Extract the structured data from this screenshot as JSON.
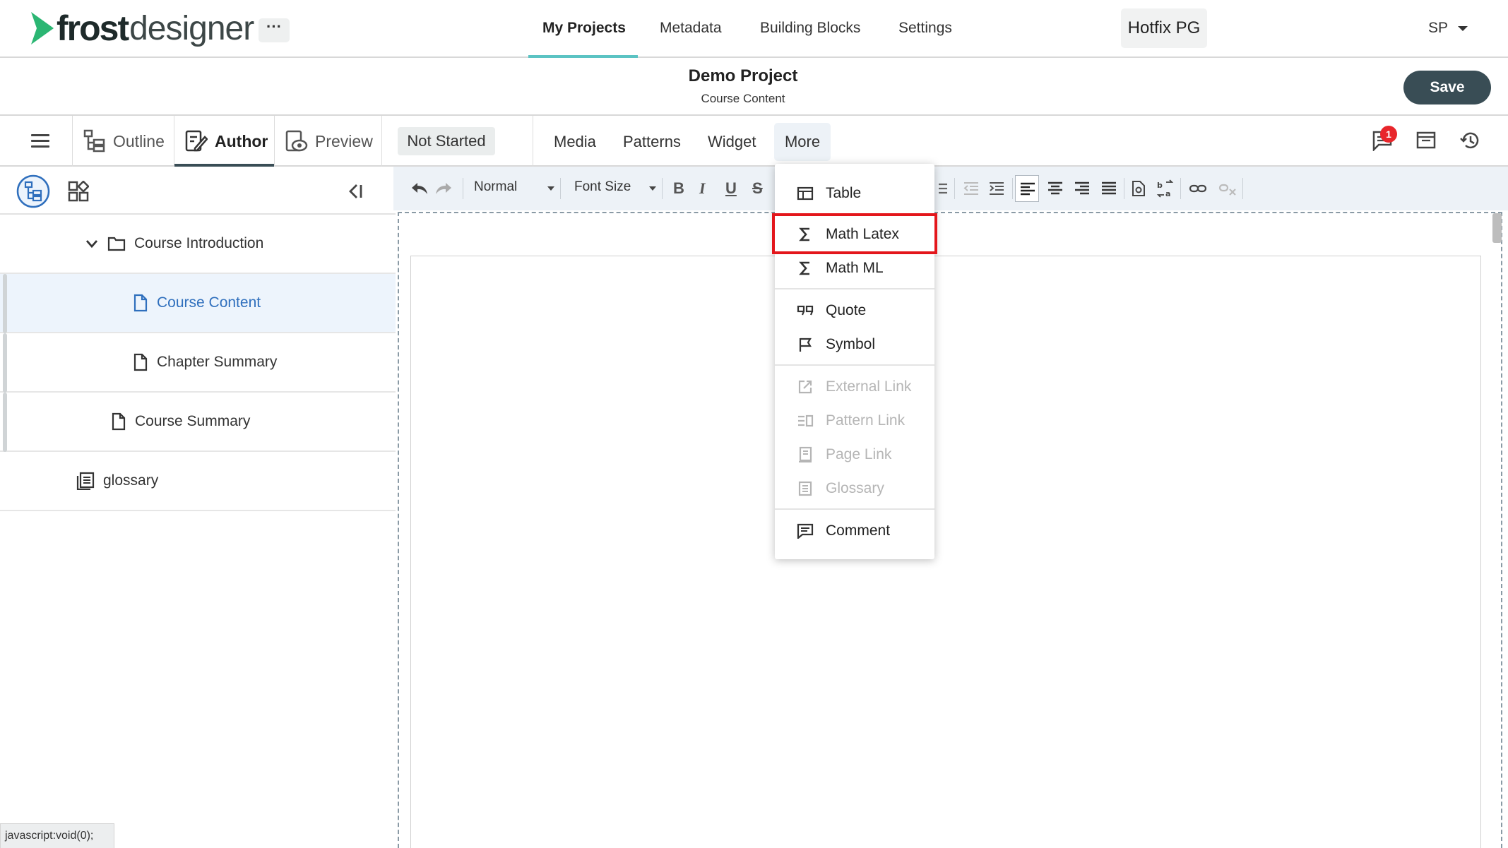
{
  "app": {
    "logo_frost": "frost",
    "logo_designer": "designer",
    "more_dots": "···"
  },
  "nav": {
    "items": [
      "My Projects",
      "Metadata",
      "Building Blocks",
      "Settings"
    ],
    "active": "My Projects",
    "workspace": "Hotfix PG",
    "user": "SP"
  },
  "project": {
    "title": "Demo Project",
    "subtitle": "Course Content",
    "save_label": "Save"
  },
  "modes": {
    "outline": "Outline",
    "author": "Author",
    "preview": "Preview",
    "status": "Not Started",
    "insert_items": [
      "Media",
      "Patterns",
      "Widget",
      "More"
    ],
    "notification_count": "1"
  },
  "sidebar": {
    "tree": [
      {
        "label": "Course Introduction",
        "type": "folder"
      },
      {
        "label": "Course Content",
        "type": "page",
        "selected": true
      },
      {
        "label": "Chapter Summary",
        "type": "page"
      },
      {
        "label": "Course Summary",
        "type": "page"
      },
      {
        "label": "glossary",
        "type": "glossary"
      }
    ]
  },
  "editor_toolbar": {
    "paragraph_style": "Normal",
    "font_size": "Font Size",
    "bold": "B",
    "italic": "I",
    "underline": "U",
    "strike": "S"
  },
  "more_menu": {
    "items": [
      {
        "label": "Table",
        "icon": "table-icon",
        "enabled": true
      },
      {
        "label": "Math Latex",
        "icon": "sigma-icon",
        "enabled": true,
        "highlighted": true
      },
      {
        "label": "Math ML",
        "icon": "sigma-icon",
        "enabled": true
      },
      {
        "label": "Quote",
        "icon": "quote-icon",
        "enabled": true
      },
      {
        "label": "Symbol",
        "icon": "flag-icon",
        "enabled": true
      },
      {
        "label": "External Link",
        "icon": "external-link-icon",
        "enabled": false
      },
      {
        "label": "Pattern Link",
        "icon": "pattern-link-icon",
        "enabled": false
      },
      {
        "label": "Page Link",
        "icon": "page-link-icon",
        "enabled": false
      },
      {
        "label": "Glossary",
        "icon": "glossary-icon",
        "enabled": false
      },
      {
        "label": "Comment",
        "icon": "comment-icon",
        "enabled": true
      }
    ],
    "highlight_color": "#e3161b"
  },
  "statusbar": {
    "text": "javascript:void(0);"
  },
  "colors": {
    "brand_green": "#2bb673",
    "save_button": "#394d55",
    "nav_active_underline": "#5bc3c3",
    "selected_row": "#edf4fc",
    "selected_text": "#2f6fbd"
  }
}
